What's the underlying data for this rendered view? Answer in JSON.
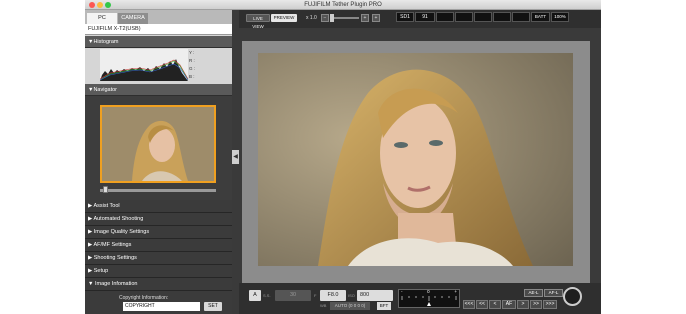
{
  "window": {
    "title": "FUJIFILM Tether Plugin PRO"
  },
  "tabs": [
    {
      "label": "PC"
    },
    {
      "label": "CAMERA"
    }
  ],
  "camera_name": "FUJIFILM X-T2(USB)",
  "sections": {
    "histogram": "▼Histogram",
    "navigator": "▼Navigator",
    "histogram_channels": [
      "Y :",
      "R :",
      "G :",
      "B :"
    ]
  },
  "menu_items": [
    "▶ Assist Tool",
    "▶ Automated Shooting",
    "▶ Image Quality Settings",
    "▶ AF/MF Settings",
    "▶ Shooting Settings",
    "▶ Setup",
    "▼ Image Infomation"
  ],
  "copyright": {
    "label": "Copyright Information:",
    "value": "COPYRIGHT",
    "set_label": "SET"
  },
  "collapse_glyph": "◀",
  "toolbar": {
    "live_view": "LIVE VIEW",
    "preview": "PREVIEW",
    "zoom": "x 1.0",
    "zoom_minus": "−",
    "zoom_plus_1": "+",
    "zoom_plus_2": "+"
  },
  "status": {
    "card": "SD1",
    "frames": "91",
    "batt_label": "BATT",
    "batt_value": "100%"
  },
  "controls": {
    "mode": "A",
    "mode_sub": "S.S.",
    "shutter": "30",
    "f_label": "F",
    "aperture": "F8.0",
    "iso_label": "ISO",
    "iso": "800",
    "wb_label": "WB",
    "wb": "AUTO (0 0 0 0)",
    "bft": "BFT",
    "meter_scale": [
      "-",
      "0",
      "+"
    ]
  },
  "nav_buttons": [
    "<<<",
    "<<",
    "<",
    "AF",
    ">",
    ">>",
    ">>>"
  ],
  "ae_buttons": [
    "AE-L",
    "AF-L"
  ],
  "colors": {
    "accent": "#f0a020",
    "panel": "#3a3a3a"
  }
}
